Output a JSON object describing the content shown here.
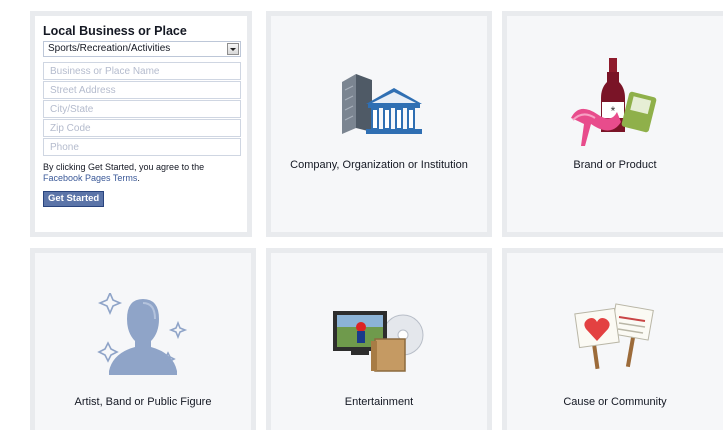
{
  "local_business": {
    "title": "Local Business or Place",
    "category_selected": "Sports/Recreation/Activities",
    "fields": {
      "name_placeholder": "Business or Place Name",
      "street_placeholder": "Street Address",
      "city_placeholder": "City/State",
      "zip_placeholder": "Zip Code",
      "phone_placeholder": "Phone"
    },
    "terms_text": "By clicking Get Started, you agree to the",
    "terms_link": "Facebook Pages Terms",
    "terms_end": ".",
    "button_label": "Get Started"
  },
  "categories": {
    "company": {
      "label": "Company, Organization or Institution",
      "icon": "company-building-icon"
    },
    "brand": {
      "label": "Brand or Product",
      "icon": "brand-product-icon"
    },
    "artist": {
      "label": "Artist, Band or Public Figure",
      "icon": "public-figure-icon"
    },
    "entertainment": {
      "label": "Entertainment",
      "icon": "entertainment-icon"
    },
    "cause": {
      "label": "Cause or Community",
      "icon": "cause-community-icon"
    }
  },
  "colors": {
    "tile_background": "#f6f7f9",
    "tile_border": "#e9ebee",
    "link": "#3b5998",
    "button": "#5b74a8"
  }
}
